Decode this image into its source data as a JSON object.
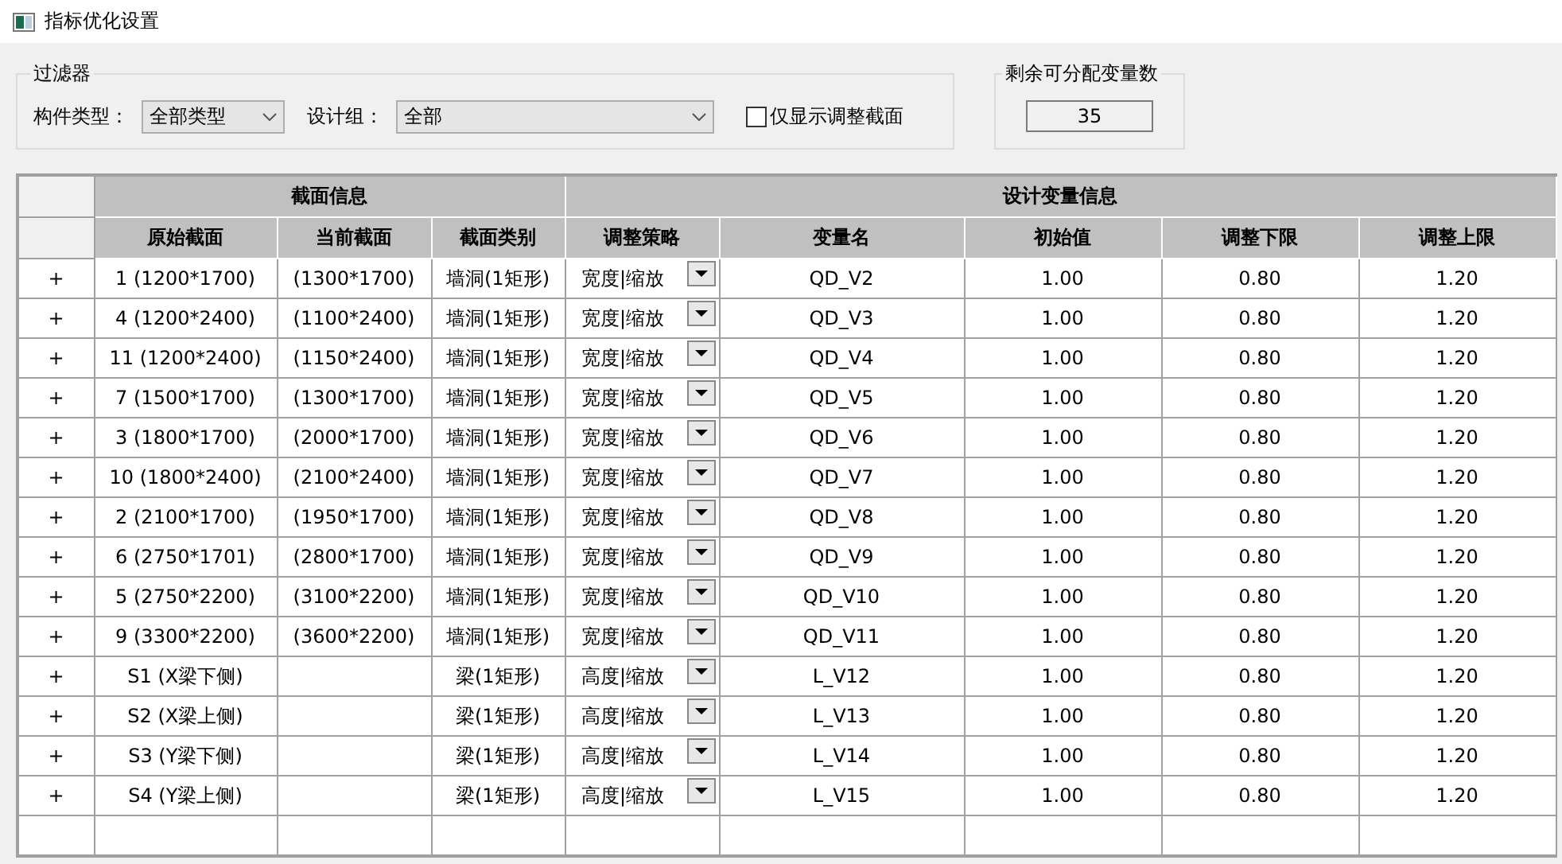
{
  "window": {
    "title": "指标优化设置"
  },
  "filter": {
    "title": "过滤器",
    "component_type": {
      "label": "构件类型：",
      "value": "全部类型"
    },
    "design_group": {
      "label": "设计组：",
      "value": "全部"
    },
    "only_adjusted": {
      "label": "仅显示调整截面",
      "checked": false
    }
  },
  "remaining": {
    "title": "剩余可分配变量数",
    "value": "35"
  },
  "table": {
    "groups": [
      "截面信息",
      "设计变量信息"
    ],
    "columns": [
      "原始截面",
      "当前截面",
      "截面类别",
      "调整策略",
      "变量名",
      "初始值",
      "调整下限",
      "调整上限"
    ],
    "rows": [
      {
        "expand": "+",
        "cells": [
          "1 (1200*1700)",
          "(1300*1700)",
          "墙洞(1矩形)",
          "宽度|缩放",
          "QD_V2",
          "1.00",
          "0.80",
          "1.20"
        ]
      },
      {
        "expand": "+",
        "cells": [
          "4 (1200*2400)",
          "(1100*2400)",
          "墙洞(1矩形)",
          "宽度|缩放",
          "QD_V3",
          "1.00",
          "0.80",
          "1.20"
        ]
      },
      {
        "expand": "+",
        "cells": [
          "11 (1200*2400)",
          "(1150*2400)",
          "墙洞(1矩形)",
          "宽度|缩放",
          "QD_V4",
          "1.00",
          "0.80",
          "1.20"
        ]
      },
      {
        "expand": "+",
        "cells": [
          "7 (1500*1700)",
          "(1300*1700)",
          "墙洞(1矩形)",
          "宽度|缩放",
          "QD_V5",
          "1.00",
          "0.80",
          "1.20"
        ]
      },
      {
        "expand": "+",
        "cells": [
          "3 (1800*1700)",
          "(2000*1700)",
          "墙洞(1矩形)",
          "宽度|缩放",
          "QD_V6",
          "1.00",
          "0.80",
          "1.20"
        ]
      },
      {
        "expand": "+",
        "cells": [
          "10 (1800*2400)",
          "(2100*2400)",
          "墙洞(1矩形)",
          "宽度|缩放",
          "QD_V7",
          "1.00",
          "0.80",
          "1.20"
        ]
      },
      {
        "expand": "+",
        "cells": [
          "2 (2100*1700)",
          "(1950*1700)",
          "墙洞(1矩形)",
          "宽度|缩放",
          "QD_V8",
          "1.00",
          "0.80",
          "1.20"
        ]
      },
      {
        "expand": "+",
        "cells": [
          "6 (2750*1701)",
          "(2800*1700)",
          "墙洞(1矩形)",
          "宽度|缩放",
          "QD_V9",
          "1.00",
          "0.80",
          "1.20"
        ]
      },
      {
        "expand": "+",
        "cells": [
          "5 (2750*2200)",
          "(3100*2200)",
          "墙洞(1矩形)",
          "宽度|缩放",
          "QD_V10",
          "1.00",
          "0.80",
          "1.20"
        ]
      },
      {
        "expand": "+",
        "cells": [
          "9 (3300*2200)",
          "(3600*2200)",
          "墙洞(1矩形)",
          "宽度|缩放",
          "QD_V11",
          "1.00",
          "0.80",
          "1.20"
        ]
      },
      {
        "expand": "+",
        "cells": [
          "S1 (X梁下侧)",
          null,
          "梁(1矩形)",
          "高度|缩放",
          "L_V12",
          "1.00",
          "0.80",
          "1.20"
        ]
      },
      {
        "expand": "+",
        "cells": [
          "S2 (X梁上侧)",
          null,
          "梁(1矩形)",
          "高度|缩放",
          "L_V13",
          "1.00",
          "0.80",
          "1.20"
        ]
      },
      {
        "expand": "+",
        "cells": [
          "S3 (Y梁下侧)",
          null,
          "梁(1矩形)",
          "高度|缩放",
          "L_V14",
          "1.00",
          "0.80",
          "1.20"
        ]
      },
      {
        "expand": "+",
        "cells": [
          "S4 (Y梁上侧)",
          null,
          "梁(1矩形)",
          "高度|缩放",
          "L_V15",
          "1.00",
          "0.80",
          "1.20"
        ]
      }
    ]
  }
}
